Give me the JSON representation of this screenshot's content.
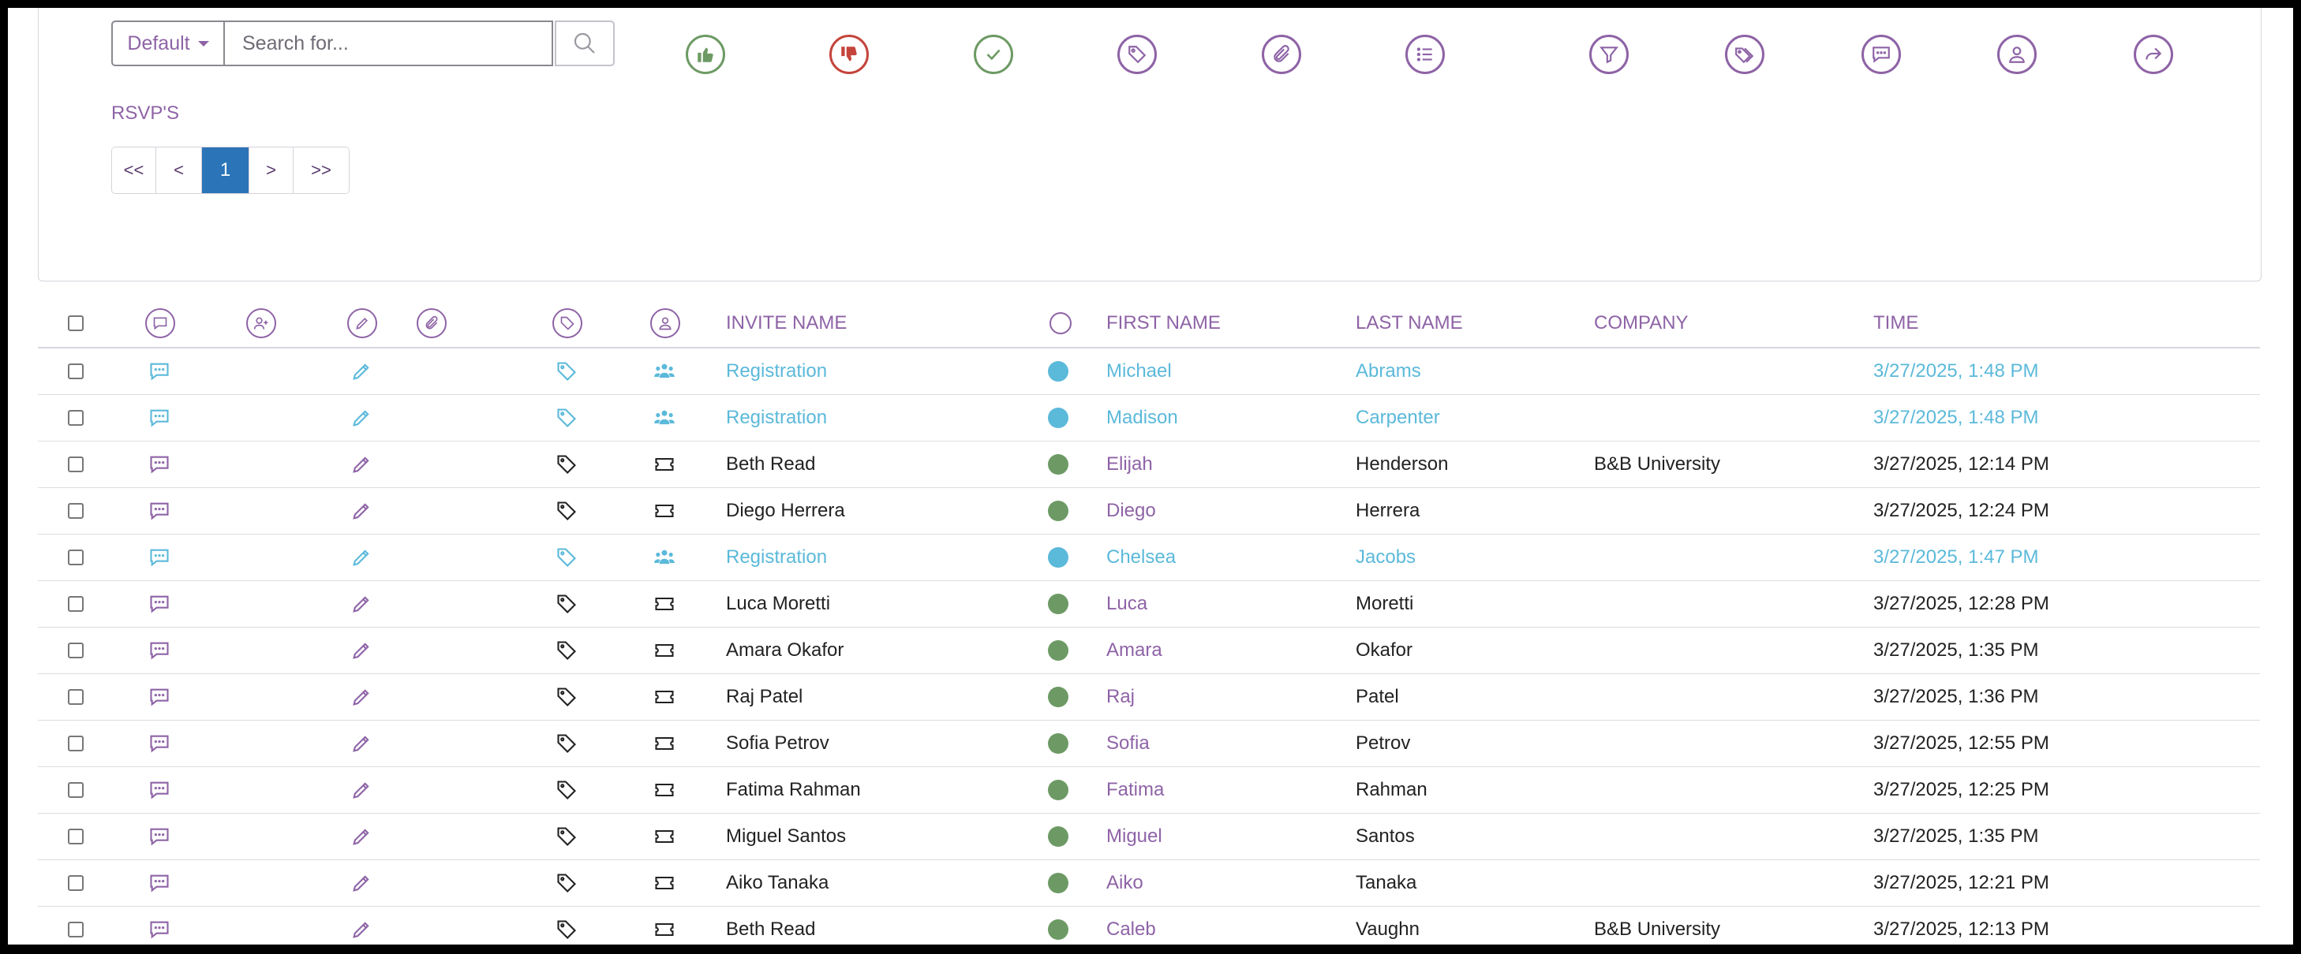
{
  "search": {
    "dropdown_label": "Default",
    "placeholder": "Search for..."
  },
  "toolbar_icons": [
    "thumbs-up-icon",
    "thumbs-down-icon",
    "check-icon",
    "tag-icon",
    "paperclip-icon",
    "list-icon",
    "filter-icon",
    "tags-icon",
    "comment-icon",
    "user-icon",
    "share-icon"
  ],
  "section_title": "RSVP'S",
  "pagination": {
    "first": "<<",
    "prev": "<",
    "current": "1",
    "next": ">",
    "last": ">>"
  },
  "table": {
    "headers": {
      "invite_name": "INVITE NAME",
      "first_name": "FIRST NAME",
      "last_name": "LAST NAME",
      "company": "COMPANY",
      "time": "TIME"
    },
    "rows": [
      {
        "type": "registration",
        "invite": "Registration",
        "first": "Michael",
        "last": "Abrams",
        "company": "",
        "time": "3/27/2025, 1:48 PM"
      },
      {
        "type": "registration",
        "invite": "Registration",
        "first": "Madison",
        "last": "Carpenter",
        "company": "",
        "time": "3/27/2025, 1:48 PM"
      },
      {
        "type": "ticket",
        "invite": "Beth Read",
        "first": "Elijah",
        "last": "Henderson",
        "company": "B&B University",
        "time": "3/27/2025, 12:14 PM"
      },
      {
        "type": "ticket",
        "invite": "Diego Herrera",
        "first": "Diego",
        "last": "Herrera",
        "company": "",
        "time": "3/27/2025, 12:24 PM"
      },
      {
        "type": "registration",
        "invite": "Registration",
        "first": "Chelsea",
        "last": "Jacobs",
        "company": "",
        "time": "3/27/2025, 1:47 PM"
      },
      {
        "type": "ticket",
        "invite": "Luca Moretti",
        "first": "Luca",
        "last": "Moretti",
        "company": "",
        "time": "3/27/2025, 12:28 PM"
      },
      {
        "type": "ticket",
        "invite": "Amara Okafor",
        "first": "Amara",
        "last": "Okafor",
        "company": "",
        "time": "3/27/2025, 1:35 PM"
      },
      {
        "type": "ticket",
        "invite": "Raj Patel",
        "first": "Raj",
        "last": "Patel",
        "company": "",
        "time": "3/27/2025, 1:36 PM"
      },
      {
        "type": "ticket",
        "invite": "Sofia Petrov",
        "first": "Sofia",
        "last": "Petrov",
        "company": "",
        "time": "3/27/2025, 12:55 PM"
      },
      {
        "type": "ticket",
        "invite": "Fatima Rahman",
        "first": "Fatima",
        "last": "Rahman",
        "company": "",
        "time": "3/27/2025, 12:25 PM"
      },
      {
        "type": "ticket",
        "invite": "Miguel Santos",
        "first": "Miguel",
        "last": "Santos",
        "company": "",
        "time": "3/27/2025, 1:35 PM"
      },
      {
        "type": "ticket",
        "invite": "Aiko Tanaka",
        "first": "Aiko",
        "last": "Tanaka",
        "company": "",
        "time": "3/27/2025, 12:21 PM"
      },
      {
        "type": "ticket",
        "invite": "Beth Read",
        "first": "Caleb",
        "last": "Vaughn",
        "company": "B&B University",
        "time": "3/27/2025, 12:13 PM"
      }
    ]
  },
  "colors": {
    "accent": "#8e63a6",
    "registration": "#5bb9da",
    "accepted": "#6d9a64",
    "declined": "#c4443b",
    "active_page": "#2b74b7"
  }
}
